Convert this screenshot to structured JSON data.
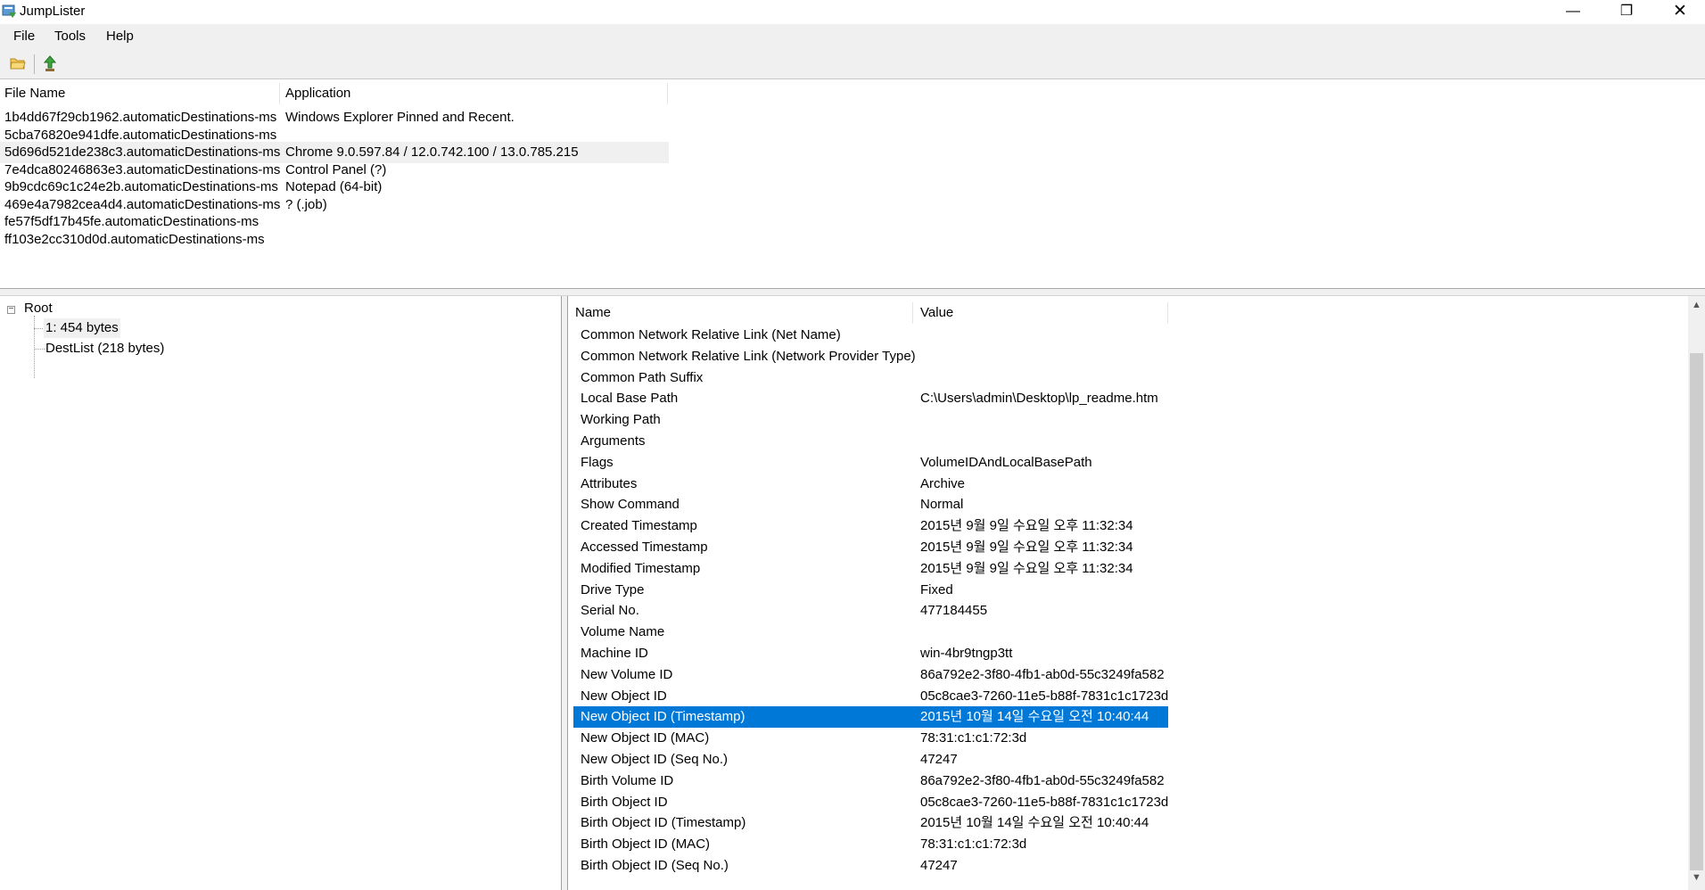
{
  "window": {
    "title": "JumpLister",
    "controls": {
      "minimize": "—",
      "maximize": "❐",
      "close": "✕"
    }
  },
  "menu": {
    "file": "File",
    "tools": "Tools",
    "help": "Help"
  },
  "toolbar": {
    "open_icon": "folder-open-icon",
    "export_icon": "export-icon"
  },
  "files": {
    "columns": {
      "name": "File Name",
      "application": "Application"
    },
    "rows": [
      {
        "name": "1b4dd67f29cb1962.automaticDestinations-ms",
        "app": "Windows Explorer Pinned and Recent."
      },
      {
        "name": "5cba76820e941dfe.automaticDestinations-ms",
        "app": ""
      },
      {
        "name": "5d696d521de238c3.automaticDestinations-ms",
        "app": "Chrome 9.0.597.84 / 12.0.742.100 / 13.0.785.215"
      },
      {
        "name": "7e4dca80246863e3.automaticDestinations-ms",
        "app": "Control Panel (?)"
      },
      {
        "name": "9b9cdc69c1c24e2b.automaticDestinations-ms",
        "app": "Notepad (64-bit)"
      },
      {
        "name": "469e4a7982cea4d4.automaticDestinations-ms",
        "app": "? (.job)"
      },
      {
        "name": "fe57f5df17b45fe.automaticDestinations-ms",
        "app": ""
      },
      {
        "name": "ff103e2cc310d0d.automaticDestinations-ms",
        "app": ""
      }
    ]
  },
  "tree": {
    "expander": "−",
    "root": "Root",
    "children": [
      "1: 454 bytes",
      "DestList (218 bytes)"
    ]
  },
  "props": {
    "columns": {
      "name": "Name",
      "value": "Value"
    },
    "rows": [
      {
        "name": "Common Network Relative Link (Net Name)",
        "value": ""
      },
      {
        "name": "Common Network Relative Link (Network Provider Type)",
        "value": ""
      },
      {
        "name": "Common Path Suffix",
        "value": ""
      },
      {
        "name": "Local Base Path",
        "value": "C:\\Users\\admin\\Desktop\\lp_readme.htm"
      },
      {
        "name": "Working Path",
        "value": ""
      },
      {
        "name": "Arguments",
        "value": ""
      },
      {
        "name": "Flags",
        "value": "VolumeIDAndLocalBasePath"
      },
      {
        "name": "Attributes",
        "value": "Archive"
      },
      {
        "name": "Show Command",
        "value": "Normal"
      },
      {
        "name": "Created Timestamp",
        "value": "2015년 9월 9일 수요일 오후 11:32:34"
      },
      {
        "name": "Accessed Timestamp",
        "value": "2015년 9월 9일 수요일 오후 11:32:34"
      },
      {
        "name": "Modified Timestamp",
        "value": "2015년 9월 9일 수요일 오후 11:32:34"
      },
      {
        "name": "Drive Type",
        "value": "Fixed"
      },
      {
        "name": "Serial No.",
        "value": "477184455"
      },
      {
        "name": "Volume Name",
        "value": ""
      },
      {
        "name": "Machine ID",
        "value": "win-4br9tngp3tt"
      },
      {
        "name": "New Volume ID",
        "value": "86a792e2-3f80-4fb1-ab0d-55c3249fa582"
      },
      {
        "name": "New Object ID",
        "value": "05c8cae3-7260-11e5-b88f-7831c1c1723d"
      },
      {
        "name": "New Object ID (Timestamp)",
        "value": "2015년 10월 14일 수요일 오전 10:40:44"
      },
      {
        "name": "New Object ID (MAC)",
        "value": "78:31:c1:c1:72:3d"
      },
      {
        "name": "New Object ID (Seq No.)",
        "value": "47247"
      },
      {
        "name": "Birth Volume ID",
        "value": "86a792e2-3f80-4fb1-ab0d-55c3249fa582"
      },
      {
        "name": "Birth Object ID",
        "value": "05c8cae3-7260-11e5-b88f-7831c1c1723d"
      },
      {
        "name": "Birth Object ID (Timestamp)",
        "value": "2015년 10월 14일 수요일 오전 10:40:44"
      },
      {
        "name": "Birth Object ID (MAC)",
        "value": "78:31:c1:c1:72:3d"
      },
      {
        "name": "Birth Object ID (Seq No.)",
        "value": "47247"
      }
    ]
  },
  "scrollbar": {
    "up": "▲",
    "down": "▼"
  },
  "colors": {
    "selection": "#0078d7",
    "chrome": "#f0f0f0"
  }
}
